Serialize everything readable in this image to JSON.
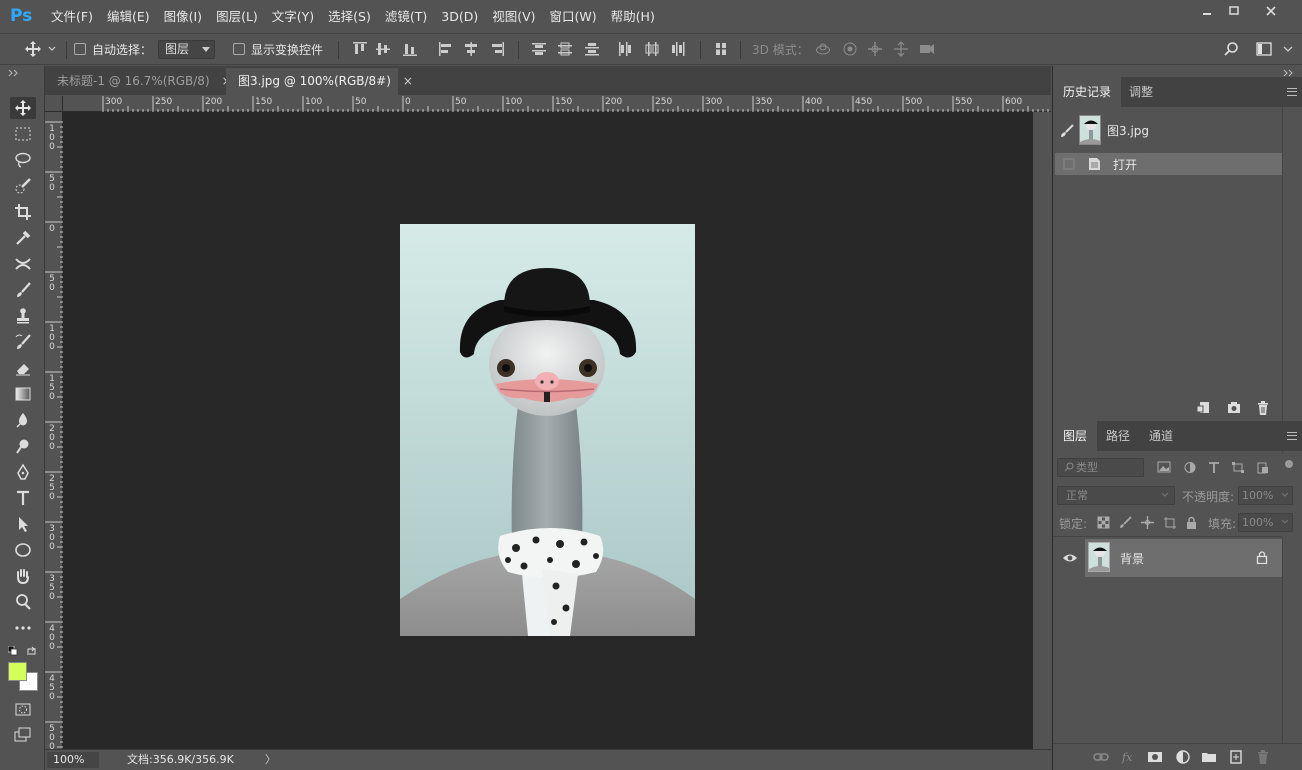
{
  "app": {
    "logo": "Ps"
  },
  "menu": [
    "文件(F)",
    "编辑(E)",
    "图像(I)",
    "图层(L)",
    "文字(Y)",
    "选择(S)",
    "滤镜(T)",
    "3D(D)",
    "视图(V)",
    "窗口(W)",
    "帮助(H)"
  ],
  "window_controls": [
    "minimize-icon",
    "maximize-icon",
    "close-icon"
  ],
  "options": {
    "auto_select_label": "自动选择：",
    "auto_select_value": "图层",
    "show_transform_label": "显示变换控件",
    "mode_3d_label": "3D 模式："
  },
  "tabs": [
    {
      "label": "未标题-1 @ 16.7%(RGB/8)",
      "close": "×",
      "active": false
    },
    {
      "label": "图3.jpg @ 100%(RGB/8#)",
      "close": "×",
      "active": true
    }
  ],
  "ruler_h": [
    "300",
    "250",
    "200",
    "150",
    "100",
    "50",
    "0",
    "50",
    "100",
    "150",
    "200",
    "250",
    "300",
    "350",
    "400",
    "450",
    "500",
    "550",
    "600"
  ],
  "ruler_v": [
    "100",
    "50",
    "0",
    "50",
    "100",
    "150",
    "200",
    "250",
    "300",
    "350",
    "400",
    "450",
    "500"
  ],
  "status": {
    "zoom": "100%",
    "doc_size": "文档:356.9K/356.9K",
    "arrow": "〉"
  },
  "history_panel": {
    "tabs": [
      "历史记录",
      "调整"
    ],
    "snapshot_name": "图3.jpg",
    "steps": [
      "打开"
    ]
  },
  "layers_panel": {
    "tabs": [
      "图层",
      "路径",
      "通道"
    ],
    "filter_placeholder": "类型",
    "blend_mode": "正常",
    "opacity_label": "不透明度:",
    "opacity_value": "100%",
    "lock_label": "锁定:",
    "fill_label": "填充:",
    "fill_value": "100%",
    "layers": [
      {
        "name": "背景",
        "visible": true,
        "locked": true
      }
    ]
  },
  "colors": {
    "accent": "#31a8ff",
    "foreground_color": "#d4ff5a",
    "background_color": "#ffffff",
    "canvas_bg": "#282828",
    "ui_bg": "#535353"
  }
}
